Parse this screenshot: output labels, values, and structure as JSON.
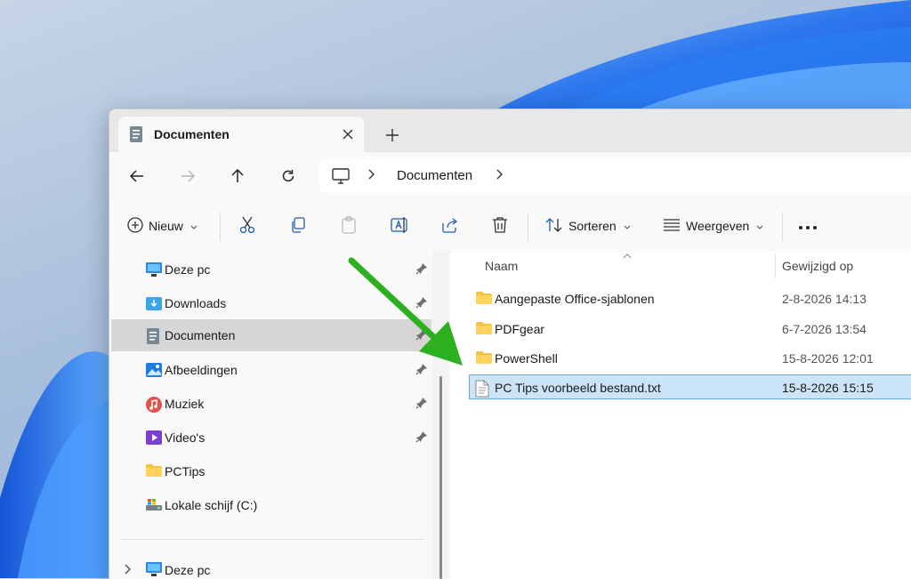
{
  "colors": {
    "accent_arrow": "#2db01f",
    "selection_bg": "#cce4f7",
    "selection_border": "#69a7dd",
    "folder_yellow": "#f5c242",
    "wallpaper_blue": "#1e6fe8"
  },
  "tab": {
    "title": "Documenten",
    "icon": "document-icon",
    "close_icon": "close-icon",
    "new_tab_icon": "plus-icon"
  },
  "nav": {
    "back_icon": "arrow-left-icon",
    "forward_icon": "arrow-right-icon",
    "up_icon": "arrow-up-icon",
    "refresh_icon": "refresh-icon",
    "address": {
      "root_icon": "computer-icon",
      "crumb": "Documenten"
    }
  },
  "toolbar": {
    "new_label": "Nieuw",
    "sort_label": "Sorteren",
    "view_label": "Weergeven",
    "icons": [
      "plus-circle-icon",
      "cut-icon",
      "copy-icon",
      "paste-icon",
      "rename-icon",
      "share-icon",
      "delete-icon",
      "sort-icon",
      "view-icon",
      "more-icon"
    ]
  },
  "sidebar": {
    "items": [
      {
        "label": "Deze pc",
        "icon": "computer-icon",
        "pinned": true
      },
      {
        "label": "Downloads",
        "icon": "downloads-folder-icon",
        "pinned": true
      },
      {
        "label": "Documenten",
        "icon": "documents-icon",
        "pinned": true,
        "selected": true
      },
      {
        "label": "Afbeeldingen",
        "icon": "pictures-icon",
        "pinned": true
      },
      {
        "label": "Muziek",
        "icon": "music-icon",
        "pinned": true
      },
      {
        "label": "Video's",
        "icon": "video-icon",
        "pinned": true
      },
      {
        "label": "PCTips",
        "icon": "folder-icon",
        "pinned": false
      },
      {
        "label": "Lokale schijf (C:)",
        "icon": "drive-icon",
        "pinned": false
      }
    ],
    "tree": {
      "label": "Deze pc",
      "icon": "computer-icon"
    }
  },
  "files": {
    "columns": {
      "name": "Naam",
      "modified": "Gewijzigd op"
    },
    "rows": [
      {
        "name": "Aangepaste Office-sjablonen",
        "date": "2-8-2026 14:13",
        "icon": "folder-icon",
        "selected": false
      },
      {
        "name": "PDFgear",
        "date": "6-7-2026 13:54",
        "icon": "folder-icon",
        "selected": false
      },
      {
        "name": "PowerShell",
        "date": "15-8-2026 12:01",
        "icon": "folder-icon",
        "selected": false
      },
      {
        "name": "PC Tips voorbeeld bestand.txt",
        "date": "15-8-2026 15:15",
        "icon": "text-file-icon",
        "selected": true
      }
    ]
  }
}
